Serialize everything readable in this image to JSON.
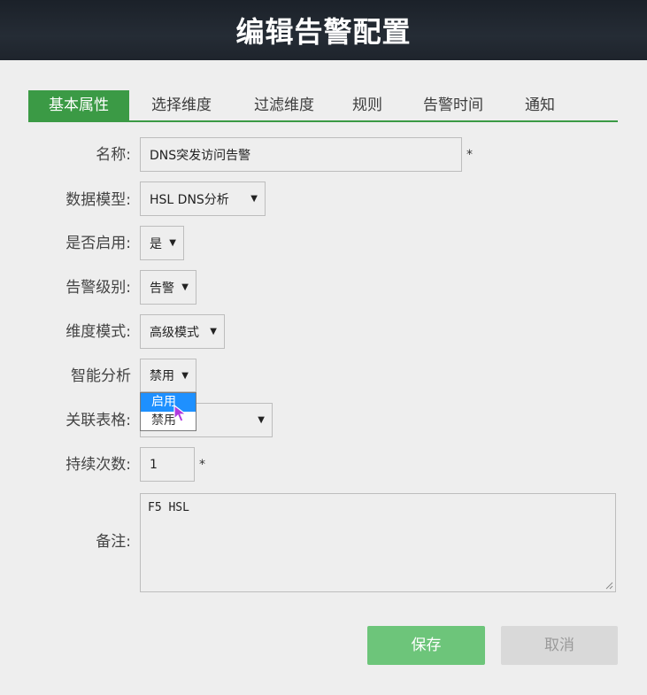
{
  "header": {
    "title": "编辑告警配置"
  },
  "tabs": [
    {
      "label": "基本属性",
      "active": true
    },
    {
      "label": "选择维度"
    },
    {
      "label": "过滤维度"
    },
    {
      "label": "规则"
    },
    {
      "label": "告警时间"
    },
    {
      "label": "通知"
    }
  ],
  "form": {
    "name": {
      "label": "名称:",
      "value": "DNS突发访问告警",
      "required": "*"
    },
    "data_model": {
      "label": "数据模型:",
      "value": "HSL DNS分析"
    },
    "enabled": {
      "label": "是否启用:",
      "value": "是"
    },
    "alert_level": {
      "label": "告警级别:",
      "value": "告警"
    },
    "dimension_mode": {
      "label": "维度模式:",
      "value": "高级模式"
    },
    "smart_analysis": {
      "label": "智能分析",
      "value": "禁用",
      "options": [
        "启用",
        "禁用"
      ],
      "highlighted": "启用"
    },
    "related_table": {
      "label": "关联表格:",
      "value": ""
    },
    "duration_count": {
      "label": "持续次数:",
      "value": "1",
      "required": "*"
    },
    "remarks": {
      "label": "备注:",
      "value": "F5 HSL"
    }
  },
  "buttons": {
    "save": "保存",
    "cancel": "取消"
  },
  "icons": {
    "caret": "caret-down-icon",
    "cursor": "mouse-cursor-icon"
  },
  "colors": {
    "accent": "#3b9a45",
    "save": "#6dc57a",
    "highlight": "#1e90ff"
  }
}
